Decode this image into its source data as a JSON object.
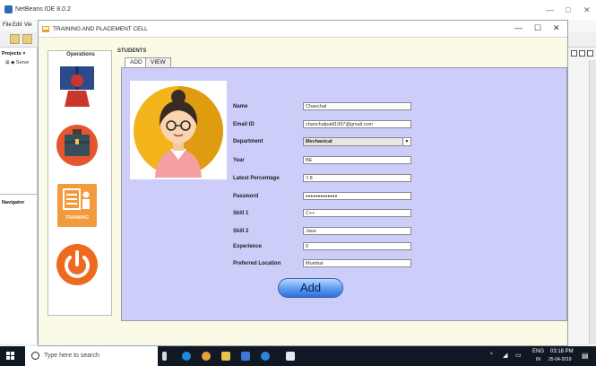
{
  "ide": {
    "title": "NetBeans IDE 8.0.2",
    "menu": [
      "File",
      "Edit",
      "Vie"
    ],
    "projects_tab": "Projects ×",
    "tree_item": "Serve",
    "navigator_tab": "Navigator",
    "window_controls": [
      "—",
      "□",
      "✕"
    ]
  },
  "app": {
    "title": "TRAINING AND PLACEMENT CELL",
    "window_controls": [
      "—",
      "☐",
      "✕"
    ],
    "operations": {
      "title": "Operations",
      "training_label": "TRAINING"
    },
    "students": {
      "title": "STUDENTS",
      "tabs": [
        "ADD",
        "VIEW"
      ]
    },
    "form": {
      "name_label": "Name",
      "name_value": "Chanchal",
      "email_label": "Email ID",
      "email_value": "chanchalpatil1997@gmail.com",
      "department_label": "Department",
      "department_value": "Mechanical",
      "year_label": "Year",
      "year_value": "BE",
      "percentage_label": "Latest Percentage",
      "percentage_value": "7.8",
      "password_label": "Password",
      "password_value": "●●●●●●●●●●●●●",
      "skill1_label": "Skill 1",
      "skill1_value": "C++",
      "skill2_label": "Skill 2",
      "skill2_value": "Java",
      "experience_label": "Experience",
      "experience_value": "0",
      "location_label": "Preferred Location",
      "location_value": "Mumbai",
      "add_label": "Add"
    }
  },
  "taskbar": {
    "search_placeholder": "Type here to search",
    "lang": "ENG",
    "lang_sub": "IN",
    "time": "03:18 PM",
    "date": "25-04-2019"
  },
  "colors": {
    "form_bg": "#cccdf9",
    "app_bg": "#fafae6",
    "operations_icons": [
      "#c8372d",
      "#e5562f",
      "#f29a3c",
      "#ee6a1f"
    ],
    "taskbar": "#101923"
  }
}
